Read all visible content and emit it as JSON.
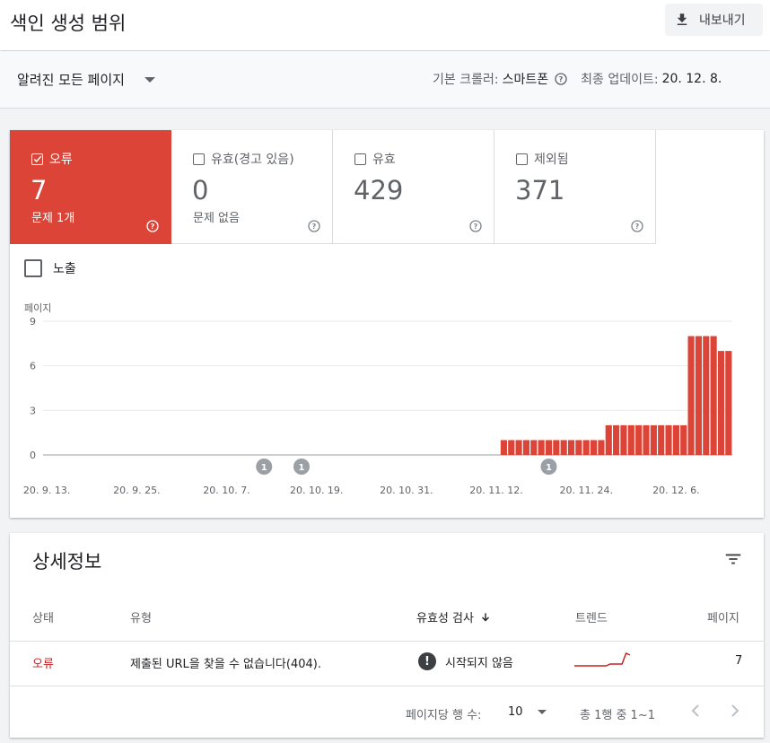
{
  "header": {
    "title": "색인 생성 범위",
    "export_label": "내보내기"
  },
  "filter": {
    "page_select": "알려진 모든 페이지",
    "crawler_label": "기본 크롤러:",
    "crawler_value": "스마트폰",
    "updated_label": "최종 업데이트:",
    "updated_value": "20. 12. 8."
  },
  "tiles": [
    {
      "label": "오류",
      "value": "7",
      "sub": "문제 1개",
      "checked": true
    },
    {
      "label": "유효(경고 있음)",
      "value": "0",
      "sub": "문제 없음",
      "checked": false
    },
    {
      "label": "유효",
      "value": "429",
      "sub": "",
      "checked": false
    },
    {
      "label": "제외됨",
      "value": "371",
      "sub": "",
      "checked": false
    }
  ],
  "impressions_label": "노출",
  "colors": {
    "error": "#db4437",
    "error_text": "#c5221f",
    "grid": "#e8eaed"
  },
  "chart_data": {
    "type": "bar",
    "ylabel": "페이지",
    "ylim": [
      0,
      9
    ],
    "yticks": [
      0,
      3,
      6,
      9
    ],
    "xtick_labels": [
      "20. 9. 13.",
      "20. 9. 25.",
      "20. 10. 7.",
      "20. 10. 19.",
      "20. 10. 31.",
      "20. 11. 12.",
      "20. 11. 24.",
      "20. 12. 6."
    ],
    "start_label_index": 0,
    "series": [
      {
        "values": [
          0,
          0,
          0,
          0,
          0,
          0,
          0,
          0,
          0,
          0,
          0,
          0,
          0,
          0,
          0,
          0,
          0,
          0,
          0,
          0,
          0,
          0,
          0,
          0,
          0,
          0,
          0,
          0,
          0,
          0,
          0,
          0,
          0,
          0,
          0,
          0,
          0,
          0,
          0,
          0,
          0,
          0,
          0,
          0,
          0,
          0,
          0,
          0,
          0,
          0,
          0,
          0,
          0,
          0,
          0,
          0,
          0,
          0,
          0,
          0,
          0,
          1,
          1,
          1,
          1,
          1,
          1,
          1,
          1,
          1,
          1,
          1,
          1,
          1,
          1,
          2,
          2,
          2,
          2,
          2,
          2,
          2,
          2,
          2,
          2,
          2,
          8,
          8,
          8,
          8,
          7,
          7
        ]
      }
    ],
    "annotations": [
      {
        "label": "1",
        "index": 29
      },
      {
        "label": "1",
        "index": 34
      },
      {
        "label": "1",
        "index": 67
      }
    ]
  },
  "details": {
    "title": "상세정보",
    "columns": {
      "status": "상태",
      "type": "유형",
      "validation": "유효성 검사",
      "trend": "트렌드",
      "pages": "페이지"
    },
    "rows": [
      {
        "status": "오류",
        "type": "제출된 URL을 찾을 수 없습니다(404).",
        "validation": "시작되지 않음",
        "trend": [
          1,
          1,
          1,
          1,
          1,
          1,
          1,
          1,
          1,
          2,
          2,
          2,
          2,
          8,
          7
        ],
        "pages": "7"
      }
    ],
    "pager": {
      "rows_label": "페이지당 행 수:",
      "rows_value": "10",
      "range": "총 1행 중 1~1"
    }
  }
}
